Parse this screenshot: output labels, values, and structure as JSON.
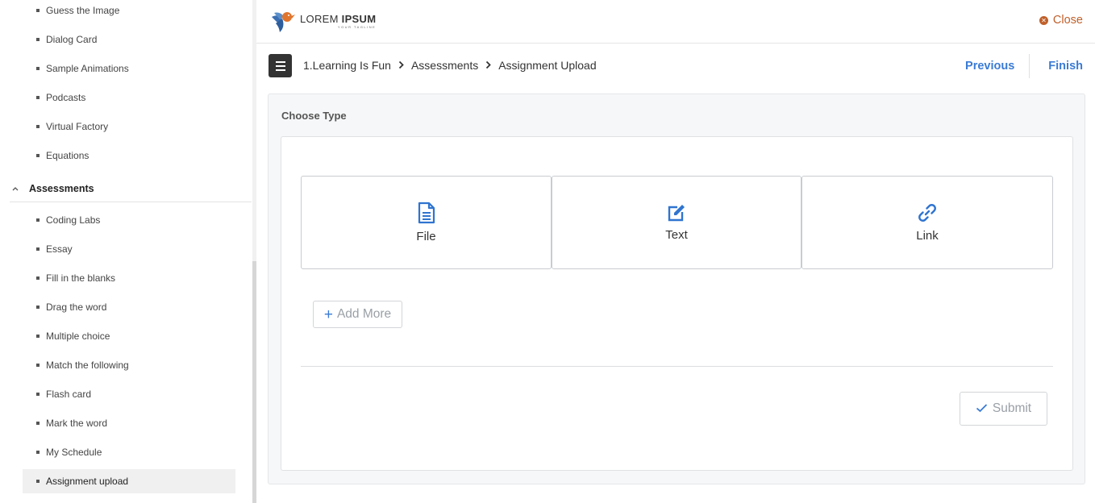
{
  "sidebar": {
    "items_top": [
      "Guess the Image",
      "Dialog Card",
      "Sample Animations",
      "Podcasts",
      "Virtual Factory",
      "Equations"
    ],
    "section_label": "Assessments",
    "items": [
      "Coding Labs",
      "Essay",
      "Fill in the blanks",
      "Drag the word",
      "Multiple choice",
      "Match the following",
      "Flash card",
      "Mark the word",
      "My Schedule",
      "Assignment upload"
    ],
    "active_item": "Assignment upload"
  },
  "header": {
    "logo_main_light": "LOREM ",
    "logo_main_bold": "IPSUM",
    "logo_tagline": "YOUR TAGLINE",
    "close_label": "Close"
  },
  "breadcrumb": {
    "items": [
      "1.Learning Is Fun",
      "Assessments",
      "Assignment Upload"
    ]
  },
  "nav": {
    "previous_label": "Previous",
    "finish_label": "Finish"
  },
  "main": {
    "panel_title": "Choose Type",
    "types": [
      {
        "label": "File",
        "icon": "file-text-icon"
      },
      {
        "label": "Text",
        "icon": "edit-icon"
      },
      {
        "label": "Link",
        "icon": "link-icon"
      }
    ],
    "add_more_label": "Add More",
    "submit_label": "Submit"
  },
  "colors": {
    "accent": "#3a7bd5",
    "close": "#c0602a",
    "menu_button": "#333333"
  }
}
